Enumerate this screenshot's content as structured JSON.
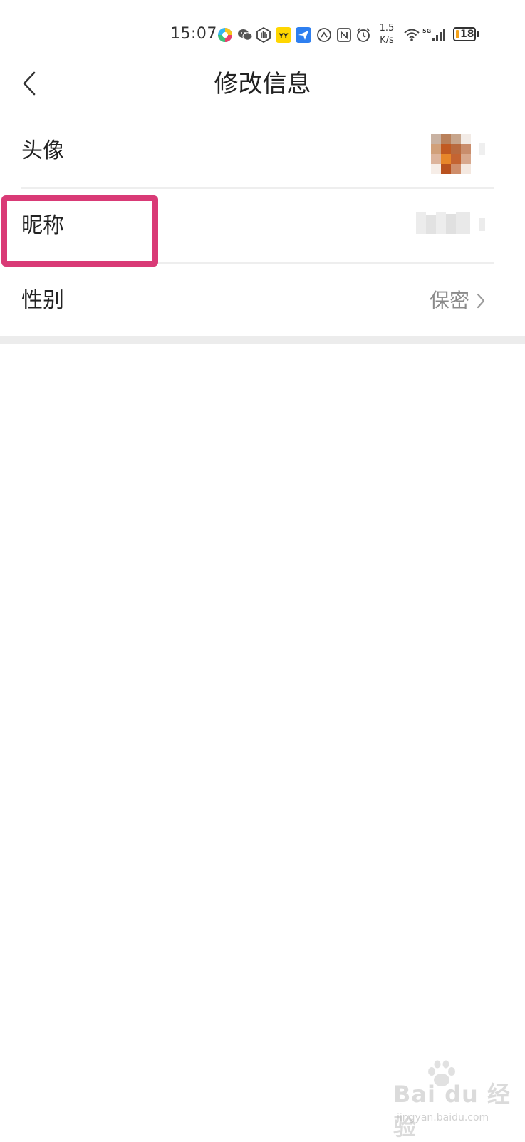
{
  "status_bar": {
    "time": "15:07",
    "net_speed_value": "1.5",
    "net_speed_unit": "K/s",
    "signal_label": "5G",
    "battery": "18",
    "battery_level_percent": 18,
    "icons": [
      "app-colorful-icon",
      "wechat-icon",
      "hand-icon",
      "yy-icon",
      "paper-plane-icon",
      "speed-icon",
      "nfc-icon",
      "alarm-icon",
      "wifi-icon",
      "signal-icon",
      "battery-icon"
    ]
  },
  "header": {
    "title": "修改信息",
    "back_icon": "chevron-left-icon"
  },
  "rows": {
    "avatar": {
      "label": "头像"
    },
    "nickname": {
      "label": "昵称"
    },
    "gender": {
      "label": "性别",
      "value": "保密",
      "icon": "chevron-right-icon"
    }
  },
  "colors": {
    "highlight": "#d93a76",
    "divider": "#eeeeee",
    "secondary_text": "#8a8a8a"
  },
  "watermark": {
    "brand": "Bai du 经验",
    "url": "jingyan.baidu.com"
  }
}
